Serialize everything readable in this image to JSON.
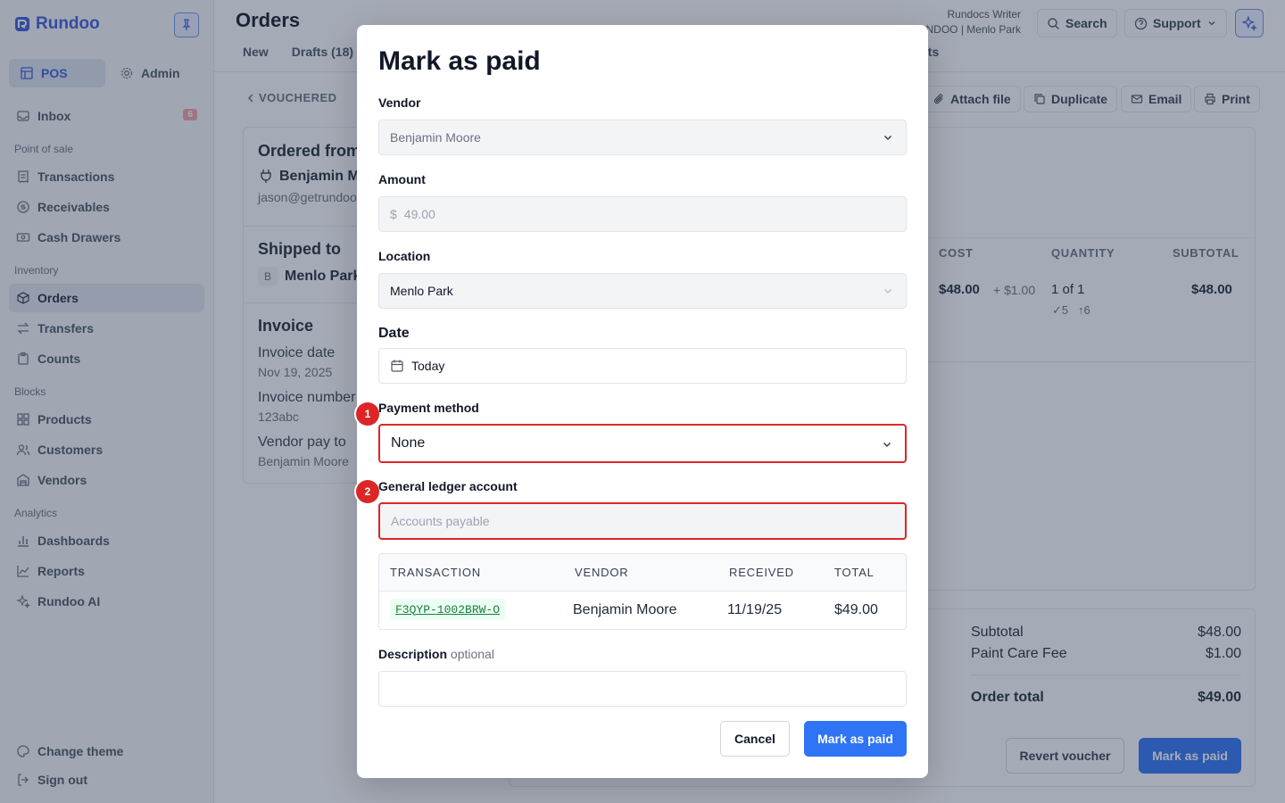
{
  "app": {
    "brand": "Rundoo"
  },
  "sidebar": {
    "modes": [
      {
        "label": "POS"
      },
      {
        "label": "Admin"
      }
    ],
    "inbox": {
      "label": "Inbox",
      "count": "6"
    },
    "sections": {
      "pos": "Point of sale",
      "inventory": "Inventory",
      "blocks": "Blocks",
      "analytics": "Analytics"
    },
    "items": {
      "transactions": "Transactions",
      "receivables": "Receivables",
      "cash_drawers": "Cash Drawers",
      "orders": "Orders",
      "transfers": "Transfers",
      "counts": "Counts",
      "products": "Products",
      "customers": "Customers",
      "vendors": "Vendors",
      "dashboards": "Dashboards",
      "reports": "Reports",
      "rundoo_ai": "Rundoo AI"
    },
    "footer": {
      "change_theme": "Change theme",
      "sign_out": "Sign out"
    }
  },
  "header": {
    "title": "Orders",
    "tabs": [
      "New",
      "Drafts (18)"
    ],
    "tab_right": "cts",
    "user_name": "Rundocs Writer",
    "user_location": "NDOO | Menlo Park",
    "search_label": "Search",
    "support_label": "Support"
  },
  "order": {
    "back_label": "VOUCHERED",
    "actions": {
      "attach": "Attach file",
      "duplicate": "Duplicate",
      "email": "Email",
      "print": "Print"
    },
    "ordered_from_label": "Ordered from",
    "vendor_name": "Benjamin M",
    "vendor_email": "jason@getrundoo",
    "shipped_to_label": "Shipped to",
    "ship_location_initial": "B",
    "ship_location": "Menlo Park",
    "invoice": {
      "heading": "Invoice",
      "date_label": "Invoice date",
      "date_value": "Nov 19, 2025",
      "number_label": "Invoice number",
      "number_value": "123abc",
      "pay_to_label": "Vendor pay to",
      "pay_to_value": "Benjamin Moore"
    },
    "line_table": {
      "headers": {
        "cost": "COST",
        "quantity": "QUANTITY",
        "subtotal": "SUBTOTAL"
      },
      "row": {
        "cost": "$48.00",
        "fee": "+ $1.00",
        "quantity": "1 of 1",
        "received": "✓5",
        "ordered": "↑6",
        "subtotal": "$48.00"
      }
    },
    "summary": {
      "subtotal_label": "Subtotal",
      "subtotal_value": "$48.00",
      "fee_label": "Paint Care Fee",
      "fee_value": "$1.00",
      "total_label": "Order total",
      "total_value": "$49.00"
    },
    "revert_label": "Revert voucher",
    "mark_paid_label": "Mark as paid"
  },
  "modal": {
    "title": "Mark as paid",
    "vendor": {
      "label": "Vendor",
      "value": "Benjamin Moore"
    },
    "amount": {
      "label": "Amount",
      "currency": "$",
      "value": "49.00"
    },
    "location": {
      "label": "Location",
      "value": "Menlo Park"
    },
    "date": {
      "label": "Date",
      "value": "Today"
    },
    "payment_method": {
      "label": "Payment method",
      "value": "None",
      "step": "1"
    },
    "gl_account": {
      "label": "General ledger account",
      "placeholder": "Accounts payable",
      "step": "2"
    },
    "transactions": {
      "headers": {
        "transaction": "TRANSACTION",
        "vendor": "VENDOR",
        "received": "RECEIVED",
        "total": "TOTAL"
      },
      "row": {
        "transaction": "F3QYP-1002BRW-O",
        "vendor": "Benjamin Moore",
        "received": "11/19/25",
        "total": "$49.00"
      }
    },
    "description": {
      "label": "Description",
      "optional": "optional",
      "value": ""
    },
    "cancel_label": "Cancel",
    "submit_label": "Mark as paid"
  },
  "colors": {
    "accent": "#2f74f5",
    "brand": "#3b5bdb",
    "highlight": "#dc2626",
    "link_green": "#15803d"
  }
}
